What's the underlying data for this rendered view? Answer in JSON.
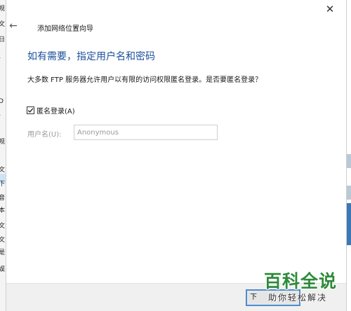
{
  "window": {
    "close_glyph": "✕",
    "back_glyph": "←",
    "title": "添加网络位置向导"
  },
  "page": {
    "heading": "如有需要，指定用户名和密码",
    "description": "大多数 FTP 服务器允许用户以有限的访问权限匿名登录。是否要匿名登录？"
  },
  "form": {
    "anonymous_checkbox": {
      "label": "匿名登录(A)",
      "checked": true
    },
    "username": {
      "label": "用户名(U):",
      "value": "Anonymous"
    }
  },
  "footer": {
    "next_button_label": "下"
  },
  "watermark": {
    "main": "百科全说",
    "sub": "助你轻松解决"
  },
  "colors": {
    "heading": "#1b4f9c",
    "watermark_green": "#2e8a3a",
    "focus_border": "#4d8ed1",
    "footer_bg": "#f0f0f0"
  },
  "background": {
    "left_strip_glyphs": [
      "规",
      "文",
      "日",
      "ł",
      "D",
      "ł",
      "i",
      "规",
      "文",
      "下",
      "音",
      "本",
      "文",
      "文",
      "是",
      "娱"
    ]
  }
}
